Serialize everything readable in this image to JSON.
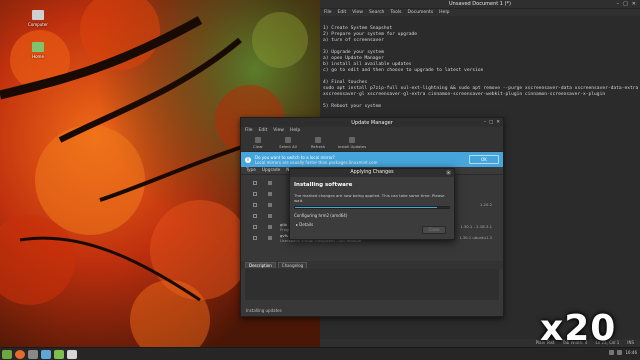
{
  "desktop": {
    "icons": [
      {
        "label": "Computer",
        "icon": "computer-icon",
        "color": "#d0d0d0"
      },
      {
        "label": "Home",
        "icon": "home-folder-icon",
        "color": "#7ec36e"
      }
    ]
  },
  "editor": {
    "title": "Unsaved Document 1 (*)",
    "menu": [
      "File",
      "Edit",
      "View",
      "Search",
      "Tools",
      "Documents",
      "Help"
    ],
    "lines": [
      "1) Create System Snapshot",
      "",
      "2) Prepare your system for upgrade",
      "a) turn of screensaver",
      "",
      "3) Upgrade your system",
      "a) open Update Manager",
      "b) install all available updates",
      "c) go to edit and then choose to upgrade to latest version",
      "",
      "4) Final touches",
      "sudo apt install p7zip-full xul-ext-lightning && sudo apt remove --purge xscreensaver-data xscreensaver-data-extra",
      "xscreensaver-gl xscreensaver-gl-extra cinnamon-screensaver-webkit-plugin cinnamon-screensaver-x-plugin",
      "",
      "5) Reboot your system"
    ],
    "status": {
      "syntax": "Plain Text",
      "tab_width": "Tab Width: 4",
      "position": "Ln 23, Col 1",
      "mode": "INS"
    }
  },
  "update_manager": {
    "title": "Update Manager",
    "menu": [
      "File",
      "Edit",
      "View",
      "Help"
    ],
    "toolbar": [
      "Clear",
      "Select All",
      "Refresh",
      "Install Updates"
    ],
    "banner": {
      "line1": "Do you want to switch to a local mirror?",
      "line2": "Local mirrors are usually faster than packages.linuxmint.com",
      "button": "OK"
    },
    "columns": [
      "Type",
      "Upgrade",
      "Name"
    ],
    "rows": [
      {
        "name": "",
        "desc": "",
        "version": ""
      },
      {
        "name": "",
        "desc": "",
        "version": ""
      },
      {
        "name": "",
        "desc": "",
        "version": "1.20.2"
      },
      {
        "name": "",
        "desc": "",
        "version": ""
      },
      {
        "name": "glib",
        "desc": "Programs for the GLib library",
        "version": "1.30.1 - 2.18-3.1"
      },
      {
        "name": "gvfs",
        "desc": "Userspace Virtual Filesystem - GIO module",
        "version": "1.30.1 ubuntu1.3"
      }
    ],
    "tabs": [
      "Description",
      "Changelog"
    ],
    "status": "Installing updates"
  },
  "apply_dialog": {
    "title": "Applying Changes",
    "heading": "Installing software",
    "description": "The marked changes are now being applied. This can take some time. Please wait.",
    "progress": 0.92,
    "configuring": "Configuring hrm2 (amd64)",
    "details_label": "Details",
    "close_label": "Close",
    "accent": "#46a5dc"
  },
  "overlay": {
    "speed": "x20"
  },
  "taskbar": {
    "apps": [
      {
        "icon": "menu-icon",
        "color": "#6ca73f"
      },
      {
        "icon": "firefox-icon",
        "color": "#e66a2c"
      },
      {
        "icon": "terminal-icon",
        "color": "#888888"
      },
      {
        "icon": "files-icon",
        "color": "#5fa7d6"
      },
      {
        "icon": "update-manager-icon",
        "color": "#7fbf4d"
      },
      {
        "icon": "text-editor-icon",
        "color": "#d6d6d6"
      }
    ],
    "clock": "16:46"
  }
}
